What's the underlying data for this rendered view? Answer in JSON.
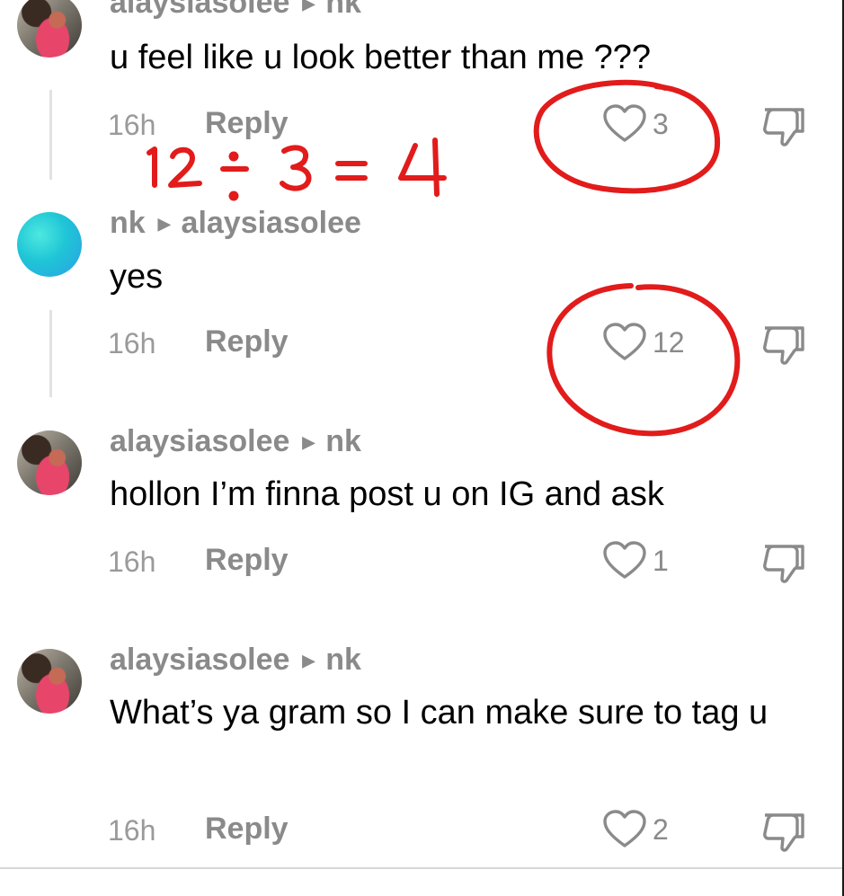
{
  "comments": [
    {
      "author": "alaysiasolee",
      "reply_to": "nk",
      "text": "u feel like u look better than me ???",
      "time": "16h",
      "reply_label": "Reply",
      "likes": "3"
    },
    {
      "author": "nk",
      "reply_to": "alaysiasolee",
      "text": "yes",
      "time": "16h",
      "reply_label": "Reply",
      "likes": "12"
    },
    {
      "author": "alaysiasolee",
      "reply_to": "nk",
      "text": "hollon I’m finna post u on IG and ask",
      "time": "16h",
      "reply_label": "Reply",
      "likes": "1"
    },
    {
      "author": "alaysiasolee",
      "reply_to": "nk",
      "text": "What’s ya gram so I can make sure to tag u",
      "time": "16h",
      "reply_label": "Reply",
      "likes": "2"
    }
  ],
  "annotation": {
    "equation": "12 ÷ 3 = 4",
    "color": "#e21b1b"
  },
  "icons": {
    "like": "heart-outline-icon",
    "dislike": "thumbs-down-icon",
    "reply_arrow": "caret-right-icon"
  }
}
